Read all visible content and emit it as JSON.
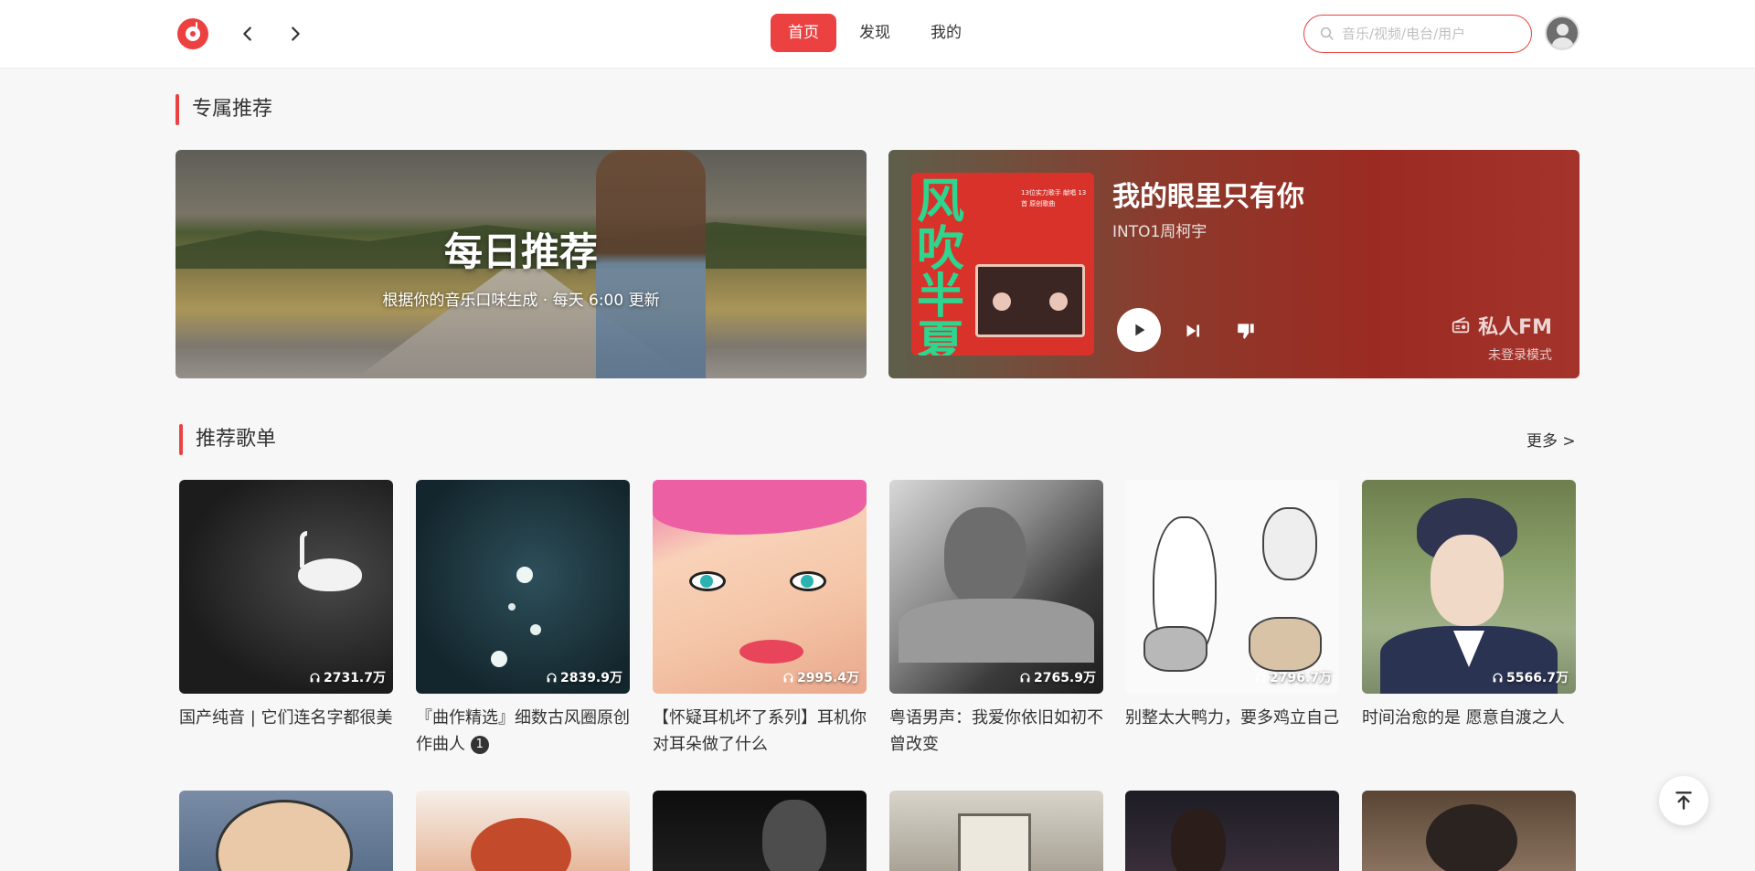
{
  "header": {
    "tabs": [
      {
        "label": "首页",
        "active": true
      },
      {
        "label": "发现",
        "active": false
      },
      {
        "label": "我的",
        "active": false
      }
    ],
    "search_placeholder": "音乐/视频/电台/用户"
  },
  "exclusive": {
    "title": "专属推荐",
    "daily": {
      "title": "每日推荐",
      "subtitle": "根据你的音乐口味生成 · 每天 6:00 更新"
    },
    "fm": {
      "song": "我的眼里只有你",
      "artist": "INTO1周柯宇",
      "label": "私人FM",
      "mode": "未登录模式",
      "cover_title": "风吹半夏",
      "cover_text": "13位实力歌手 献唱 13首 原创歌曲"
    }
  },
  "playlists": {
    "title": "推荐歌单",
    "more": "更多 >",
    "items": [
      {
        "count": "2731.7万",
        "name": "国产纯音 | 它们连名字都很美"
      },
      {
        "count": "2839.9万",
        "name": "『曲作精选』细数古风圈原创作曲人",
        "badge": "1"
      },
      {
        "count": "2995.4万",
        "name": "【怀疑耳机坏了系列】耳机你对耳朵做了什么"
      },
      {
        "count": "2765.9万",
        "name": "粤语男声：我爱你依旧如初不曾改变"
      },
      {
        "count": "2796.7万",
        "name": "别整太大鸭力，要多鸡立自己"
      },
      {
        "count": "5566.7万",
        "name": "时间治愈的是 愿意自渡之人"
      }
    ]
  },
  "colors": {
    "accent": "#ec4141",
    "background": "#f7f7f8"
  }
}
